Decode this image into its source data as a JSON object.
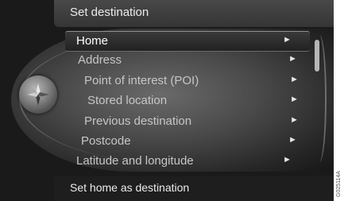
{
  "header": {
    "title": "Set destination"
  },
  "menu": {
    "items": [
      {
        "label": "Home",
        "selected": true
      },
      {
        "label": "Address",
        "selected": false
      },
      {
        "label": "Point of interest (POI)",
        "selected": false
      },
      {
        "label": "Stored location",
        "selected": false
      },
      {
        "label": "Previous destination",
        "selected": false
      },
      {
        "label": "Postcode",
        "selected": false
      },
      {
        "label": "Latitude and longitude",
        "selected": false
      }
    ],
    "arrow": "►"
  },
  "footer": {
    "hint": "Set home as destination"
  },
  "image_code": "G025114A",
  "colors": {
    "background": "#1a1a1a",
    "text": "#c6c6c6",
    "selected_text": "#ffffff"
  },
  "icons": {
    "left_knob": "compass-icon"
  }
}
